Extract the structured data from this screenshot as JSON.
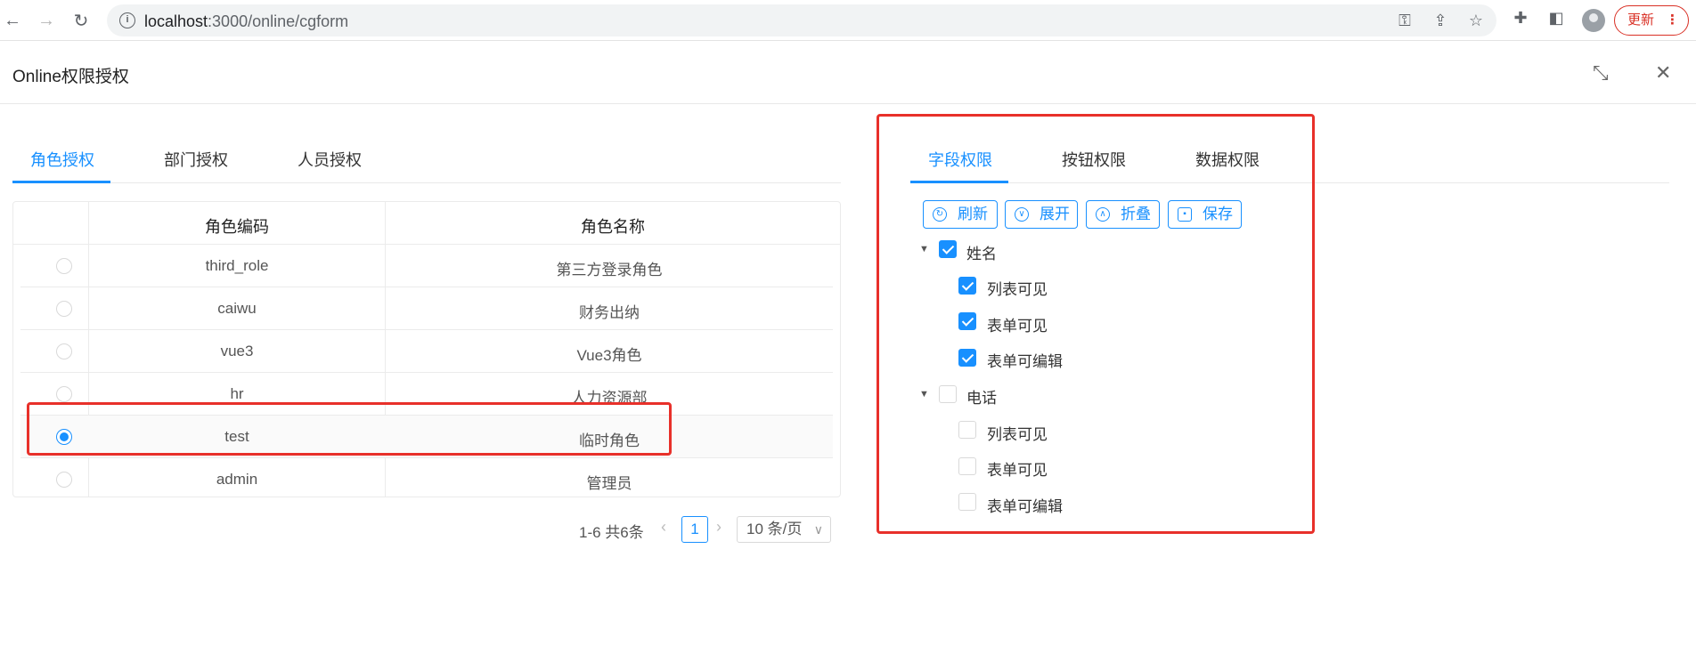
{
  "browser": {
    "url_host": "localhost",
    "url_path": ":3000/online/cgform",
    "update_label": "更新",
    "update_menu": "⋮"
  },
  "modal": {
    "title": "Online权限授权"
  },
  "left_tabs": [
    {
      "label": "角色授权",
      "active": true
    },
    {
      "label": "部门授权",
      "active": false
    },
    {
      "label": "人员授权",
      "active": false
    }
  ],
  "table": {
    "columns": [
      "角色编码",
      "角色名称"
    ],
    "rows": [
      {
        "code": "third_role",
        "name": "第三方登录角色",
        "selected": false
      },
      {
        "code": "caiwu",
        "name": "财务出纳",
        "selected": false
      },
      {
        "code": "vue3",
        "name": "Vue3角色",
        "selected": false
      },
      {
        "code": "hr",
        "name": "人力资源部",
        "selected": false
      },
      {
        "code": "test",
        "name": "临时角色",
        "selected": true
      },
      {
        "code": "admin",
        "name": "管理员",
        "selected": false
      }
    ]
  },
  "pagination": {
    "total": "1-6 共6条",
    "current_page": "1",
    "page_size": "10 条/页"
  },
  "right_tabs": [
    {
      "label": "字段权限",
      "active": true
    },
    {
      "label": "按钮权限",
      "active": false
    },
    {
      "label": "数据权限",
      "active": false
    }
  ],
  "toolbar": {
    "refresh": "刷新",
    "expand": "展开",
    "collapse": "折叠",
    "save": "保存"
  },
  "tree": [
    {
      "label": "姓名",
      "checked": true,
      "children": [
        {
          "label": "列表可见",
          "checked": true
        },
        {
          "label": "表单可见",
          "checked": true
        },
        {
          "label": "表单可编辑",
          "checked": true
        }
      ]
    },
    {
      "label": "电话",
      "checked": false,
      "children": [
        {
          "label": "列表可见",
          "checked": false
        },
        {
          "label": "表单可见",
          "checked": false
        },
        {
          "label": "表单可编辑",
          "checked": false
        }
      ]
    }
  ],
  "colors": {
    "accent": "#1890ff",
    "highlight_box": "#e8302a"
  }
}
